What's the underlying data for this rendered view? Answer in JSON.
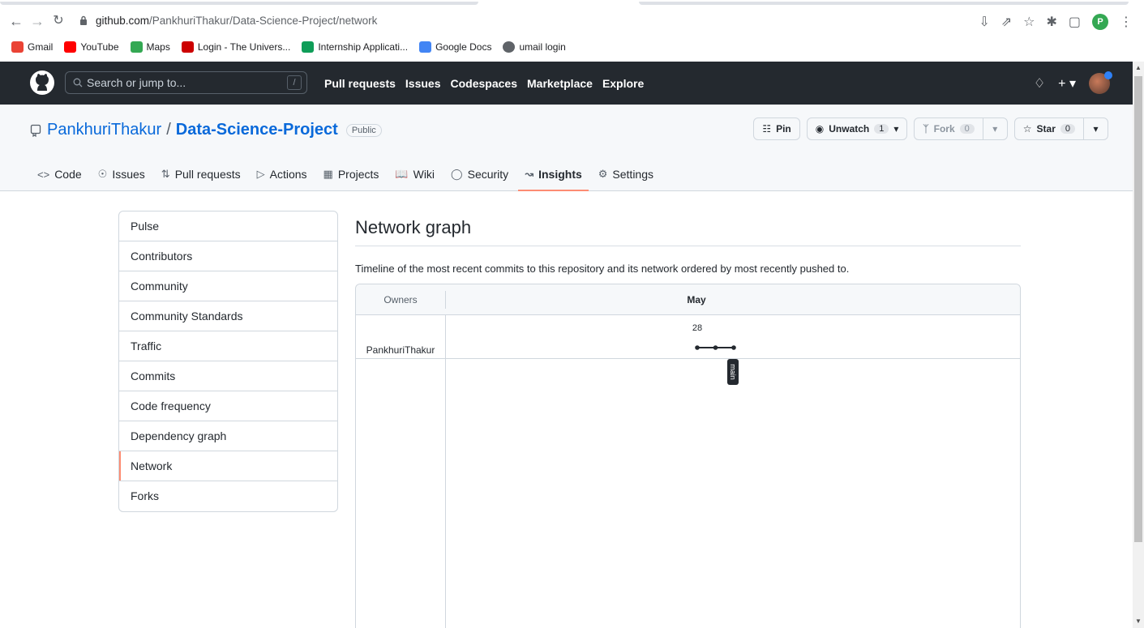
{
  "browser": {
    "url_host": "github.com",
    "url_path": "/PankhuriThakur/Data-Science-Project/network",
    "profile_initial": "P",
    "bookmarks": [
      {
        "label": "Gmail",
        "color": "#ea4335"
      },
      {
        "label": "YouTube",
        "color": "#ff0000"
      },
      {
        "label": "Maps",
        "color": "#34a853"
      },
      {
        "label": "Login - The Univers...",
        "color": "#cc0000"
      },
      {
        "label": "Internship Applicati...",
        "color": "#0f9d58"
      },
      {
        "label": "Google Docs",
        "color": "#4285f4"
      },
      {
        "label": "umail login",
        "color": "#5f6368"
      }
    ]
  },
  "gh_header": {
    "search_placeholder": "Search or jump to...",
    "search_shortcut": "/",
    "nav": [
      "Pull requests",
      "Issues",
      "Codespaces",
      "Marketplace",
      "Explore"
    ]
  },
  "repo": {
    "owner": "PankhuriThakur",
    "separator": "/",
    "name": "Data-Science-Project",
    "visibility": "Public",
    "pin_label": "Pin",
    "watch_label": "Unwatch",
    "watch_count": "1",
    "fork_label": "Fork",
    "fork_count": "0",
    "star_label": "Star",
    "star_count": "0",
    "tabs": [
      {
        "label": "Code",
        "icon": "code-icon"
      },
      {
        "label": "Issues",
        "icon": "issue-icon"
      },
      {
        "label": "Pull requests",
        "icon": "pull-request-icon"
      },
      {
        "label": "Actions",
        "icon": "play-icon"
      },
      {
        "label": "Projects",
        "icon": "table-icon"
      },
      {
        "label": "Wiki",
        "icon": "book-icon"
      },
      {
        "label": "Security",
        "icon": "shield-icon"
      },
      {
        "label": "Insights",
        "icon": "graph-icon"
      },
      {
        "label": "Settings",
        "icon": "gear-icon"
      }
    ],
    "active_tab": "Insights"
  },
  "sidebar": {
    "items": [
      "Pulse",
      "Contributors",
      "Community",
      "Community Standards",
      "Traffic",
      "Commits",
      "Code frequency",
      "Dependency graph",
      "Network",
      "Forks"
    ],
    "selected": "Network"
  },
  "main": {
    "title": "Network graph",
    "description": "Timeline of the most recent commits to this repository and its network ordered by most recently pushed to.",
    "graph": {
      "owners_header": "Owners",
      "month": "May",
      "day": "28",
      "owner": "PankhuriThakur",
      "branch": "main",
      "commit_count": 3
    }
  },
  "colors": {
    "accent_tab": "#fd8c73",
    "link": "#0969da",
    "header_bg": "#24292f"
  }
}
